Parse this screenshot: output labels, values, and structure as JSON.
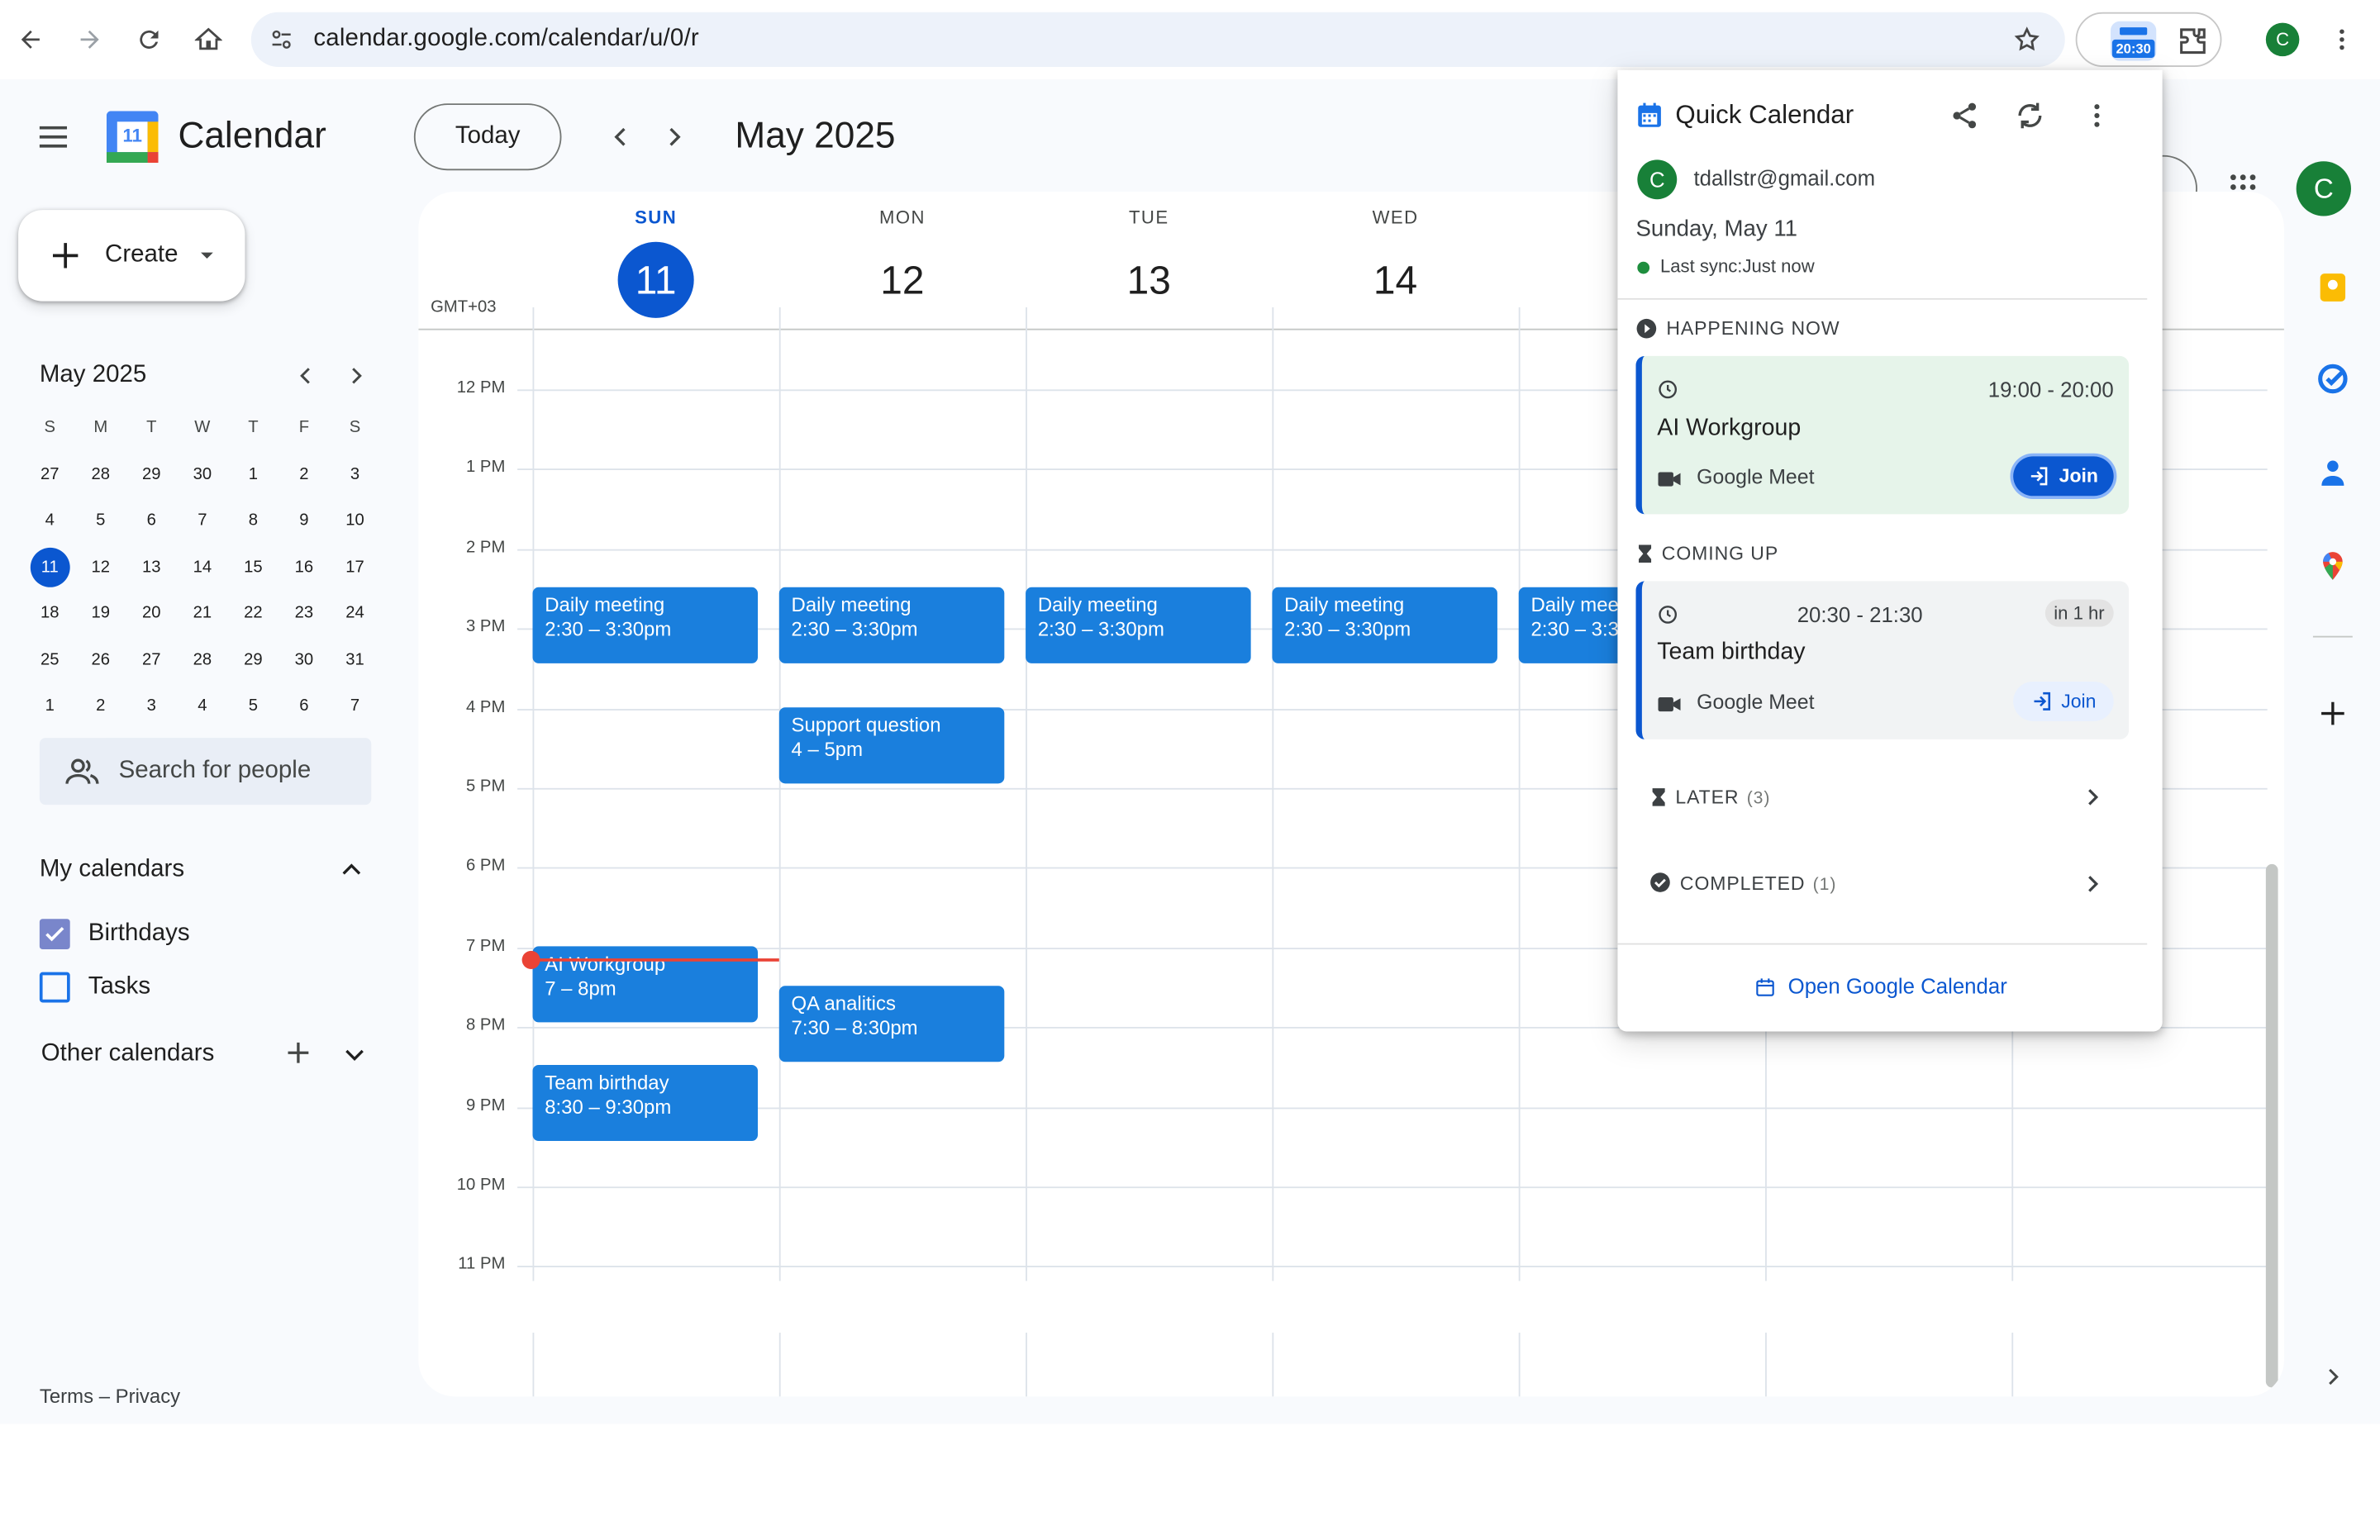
{
  "browser": {
    "url": "calendar.google.com/calendar/u/0/r",
    "extension_badge": "20:30",
    "profile_initial": "C"
  },
  "header": {
    "app_title": "Calendar",
    "logo_day": "11",
    "today_label": "Today",
    "period_title": "May 2025"
  },
  "sidebar": {
    "create_label": "Create",
    "mini_calendar": {
      "title": "May 2025",
      "weekdays": [
        "S",
        "M",
        "T",
        "W",
        "T",
        "F",
        "S"
      ],
      "weeks": [
        [
          "27",
          "28",
          "29",
          "30",
          "1",
          "2",
          "3"
        ],
        [
          "4",
          "5",
          "6",
          "7",
          "8",
          "9",
          "10"
        ],
        [
          "11",
          "12",
          "13",
          "14",
          "15",
          "16",
          "17"
        ],
        [
          "18",
          "19",
          "20",
          "21",
          "22",
          "23",
          "24"
        ],
        [
          "25",
          "26",
          "27",
          "28",
          "29",
          "30",
          "31"
        ],
        [
          "1",
          "2",
          "3",
          "4",
          "5",
          "6",
          "7"
        ]
      ],
      "today": "11"
    },
    "search_people": "Search for people",
    "my_calendars_title": "My calendars",
    "my_calendars": [
      {
        "label": "Birthdays",
        "checked": true
      },
      {
        "label": "Tasks",
        "checked": false
      }
    ],
    "other_calendars_title": "Other calendars",
    "footer": "Terms – Privacy"
  },
  "grid": {
    "timezone": "GMT+03",
    "days": [
      {
        "dow": "SUN",
        "num": "11",
        "current": true
      },
      {
        "dow": "MON",
        "num": "12",
        "current": false
      },
      {
        "dow": "TUE",
        "num": "13",
        "current": false
      },
      {
        "dow": "WED",
        "num": "14",
        "current": false
      }
    ],
    "hours": [
      "12 PM",
      "1 PM",
      "2 PM",
      "3 PM",
      "4 PM",
      "5 PM",
      "6 PM",
      "7 PM",
      "8 PM",
      "9 PM",
      "10 PM",
      "11 PM"
    ],
    "events": [
      {
        "title": "Daily meeting",
        "time": "2:30 – 3:30pm"
      },
      {
        "title": "Daily meeting",
        "time": "2:30 – 3:30pm"
      },
      {
        "title": "Daily meeting",
        "time": "2:30 – 3:30pm"
      },
      {
        "title": "Daily meeting",
        "time": "2:30 – 3:30pm"
      },
      {
        "title": "Daily mee",
        "time": "2:30 – 3:3"
      },
      {
        "title": "Support question",
        "time": "4 – 5pm"
      },
      {
        "title": "AI Workgroup",
        "time": "7 – 8pm"
      },
      {
        "title": "QA analitics",
        "time": "7:30 – 8:30pm"
      },
      {
        "title": "Team birthday",
        "time": "8:30 – 9:30pm"
      }
    ]
  },
  "popup": {
    "title": "Quick Calendar",
    "account_initial": "C",
    "email": "tdallstr@gmail.com",
    "date": "Sunday, May 11",
    "sync": "Last sync:Just now",
    "happening_now": {
      "label": "HAPPENING NOW",
      "time": "19:00 - 20:00",
      "event": "AI Workgroup",
      "meet": "Google Meet",
      "join": "Join"
    },
    "coming_up": {
      "label": "COMING UP",
      "time": "20:30 - 21:30",
      "badge": "in 1 hr",
      "event": "Team birthday",
      "meet": "Google Meet",
      "join": "Join"
    },
    "later": {
      "label": "LATER",
      "count": "(3)"
    },
    "completed": {
      "label": "COMPLETED",
      "count": "(1)"
    },
    "open_link": "Open Google Calendar"
  },
  "colors": {
    "event_blue": "#1a7fdd",
    "accent": "#0b57d0",
    "now_line": "#ea4335",
    "happening_bg": "#e6f4ea"
  }
}
